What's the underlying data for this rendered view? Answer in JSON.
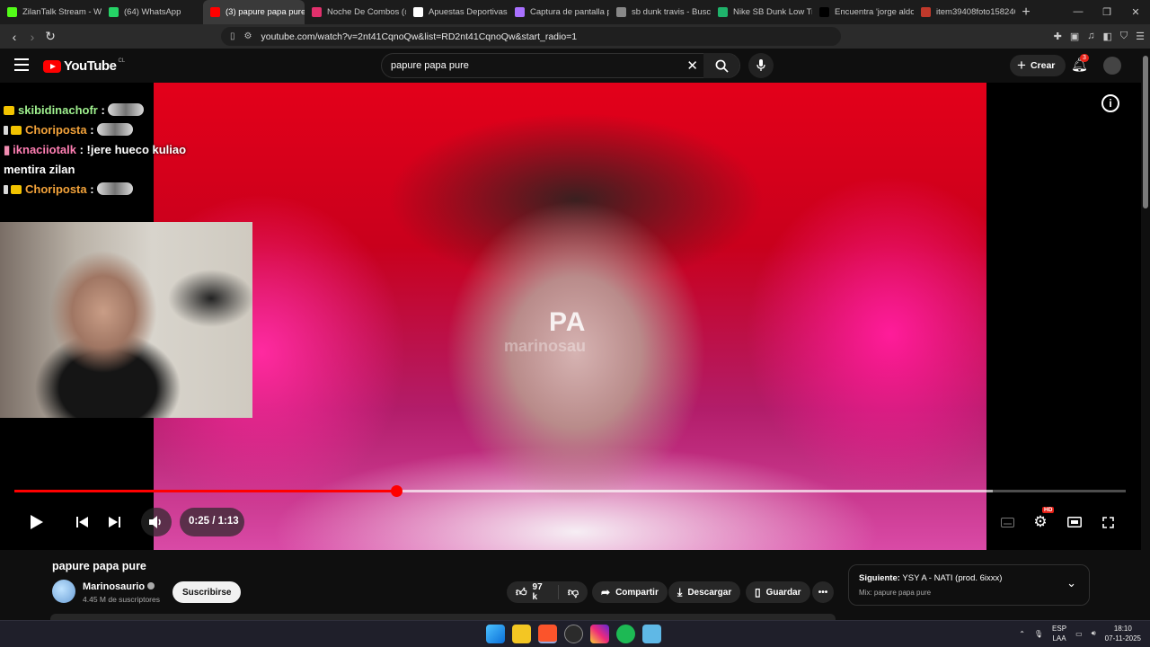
{
  "browser": {
    "tabs": [
      {
        "title": "ZilanTalk Stream - Wat",
        "color": "#53fc18"
      },
      {
        "title": "(64) WhatsApp",
        "color": "#25d366"
      },
      {
        "title": "(3) papure papa pure",
        "color": "#ff0000",
        "active": true
      },
      {
        "title": "Noche De Combos (@",
        "color": "#e1306c"
      },
      {
        "title": "Apuestas Deportivas O",
        "color": "#ffffff"
      },
      {
        "title": "Captura de pantalla pc",
        "color": "#a970ff"
      },
      {
        "title": "sb dunk travis - Buscar",
        "color": "#888888"
      },
      {
        "title": "Nike SB Dunk Low Trav",
        "color": "#1fb36b"
      },
      {
        "title": "Encuentra 'jorge aldon",
        "color": "#000000"
      },
      {
        "title": "item39408foto158246",
        "color": "#c0392b"
      }
    ],
    "url": "youtube.com/watch?v=2nt41CqnoQw&list=RD2nt41CqnoQw&start_radio=1",
    "extension_badge": "1"
  },
  "header": {
    "logo_text": "YouTube",
    "country": "CL",
    "search_value": "papure papa pure",
    "create_label": "Crear",
    "notif_count": "3"
  },
  "chat": {
    "messages": [
      {
        "user": "skibidinachofr",
        "sep": " : ",
        "text": ""
      },
      {
        "user": "Choriposta",
        "sep": " : ",
        "text": ""
      },
      {
        "user": "iknaciiotalk",
        "sep": " : ",
        "text": "!jere hueco kuliao mentira zilan"
      },
      {
        "user": "Choriposta",
        "sep": " : ",
        "text": ""
      }
    ]
  },
  "video": {
    "watermark": "PA",
    "watermark2": "marinosau",
    "current_time": "0:25",
    "duration": "1:13",
    "time_display": "0:25 / 1:13",
    "played_fraction": 0.3434,
    "loaded_fraction": 0.88,
    "quality_badge": "HD"
  },
  "meta": {
    "title": "papure papa pure",
    "channel": "Marinosaurio",
    "subscribers": "4.45 M de suscriptores",
    "subscribe_label": "Suscribirse",
    "likes": "97 k",
    "share_label": "Compartir",
    "download_label": "Descargar",
    "save_label": "Guardar",
    "more_label": "•••"
  },
  "up_next": {
    "prefix": "Siguiente:",
    "title": "YSY A - NATI (prod. 6ixxx)",
    "mix": "Mix: papure papa pure"
  },
  "taskbar": {
    "lang1": "ESP",
    "lang2": "LAA",
    "time": "18:10",
    "date": "07-11-2025"
  }
}
